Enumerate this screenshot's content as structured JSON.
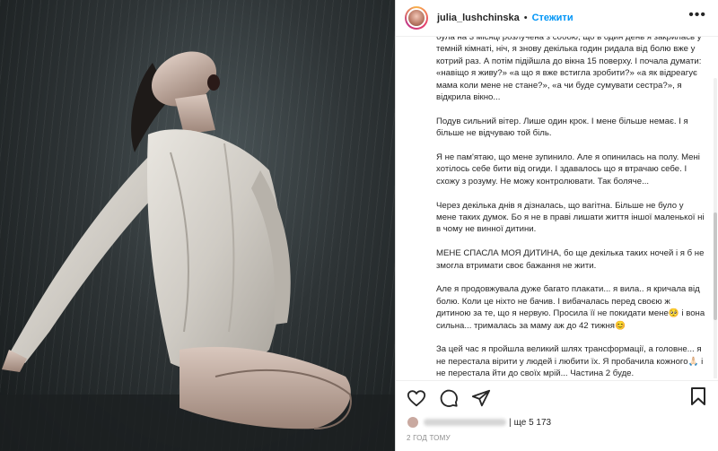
{
  "header": {
    "username": "julia_lushchinska",
    "separator": "•",
    "follow_label": "Стежити",
    "more_label": "•••"
  },
  "caption": {
    "paragraphs": [
      "була на 3 місяці розлучена з собою, що в один день я закрилась у темній кімнаті, ніч, я знову декілька годин ридала від болю вже у котрий раз. А потім підійшла до вікна 15 поверху. І почала думати: «навіщо я живу?» «а що я вже встигла зробити?» «а як відреагує мама коли мене не стане?», «а чи буде сумувати сестра?», я відкрила вікно...",
      "Подув сильний вітер. Лише один крок. І мене більше немає. І я більше не відчуваю той біль.",
      "Я не пам'ятаю, що мене зупинило. Але я опинилась на полу. Мені хотілось себе бити від огиди. І здавалось що я втрачаю себе. І схожу з розуму. Не можу контролювати. Так боляче...",
      "Через декілька днів я дізналась, що вагітна. Більше не було у мене таких думок. Бо я не в праві лишати життя іншої маленької ні в чому не винної дитини.",
      "МЕНЕ СПАСЛА МОЯ ДИТИНА, бо ще декілька таких ночей і я б не змогла втримати своє бажання не жити.",
      "Але я продовжувала дуже багато плакати... я вила.. я кричала від болю. Коли це ніхто не бачив. І вибачалась перед своєю ж дитиною за те, що я нервую. Просила її не покидати мене🥺 і вона сильна... трималась за маму аж до 42 тижня😊",
      "За цей час я пройшла великий шлях трансформації, а головне... я не перестала вірити у людей і любити їх. Я пробачила кожного🙏🏻 і не перестала йти до своїх мрій... Частина 2 буде."
    ]
  },
  "actions": {
    "like_icon": "heart-icon",
    "comment_icon": "comment-icon",
    "share_icon": "share-icon",
    "save_icon": "bookmark-icon"
  },
  "likes": {
    "separator": "|",
    "count_text": "ще 5 173"
  },
  "timestamp": "2 год тому",
  "colors": {
    "accent": "#0095f6",
    "text": "#262626",
    "muted": "#8e8e8e"
  }
}
